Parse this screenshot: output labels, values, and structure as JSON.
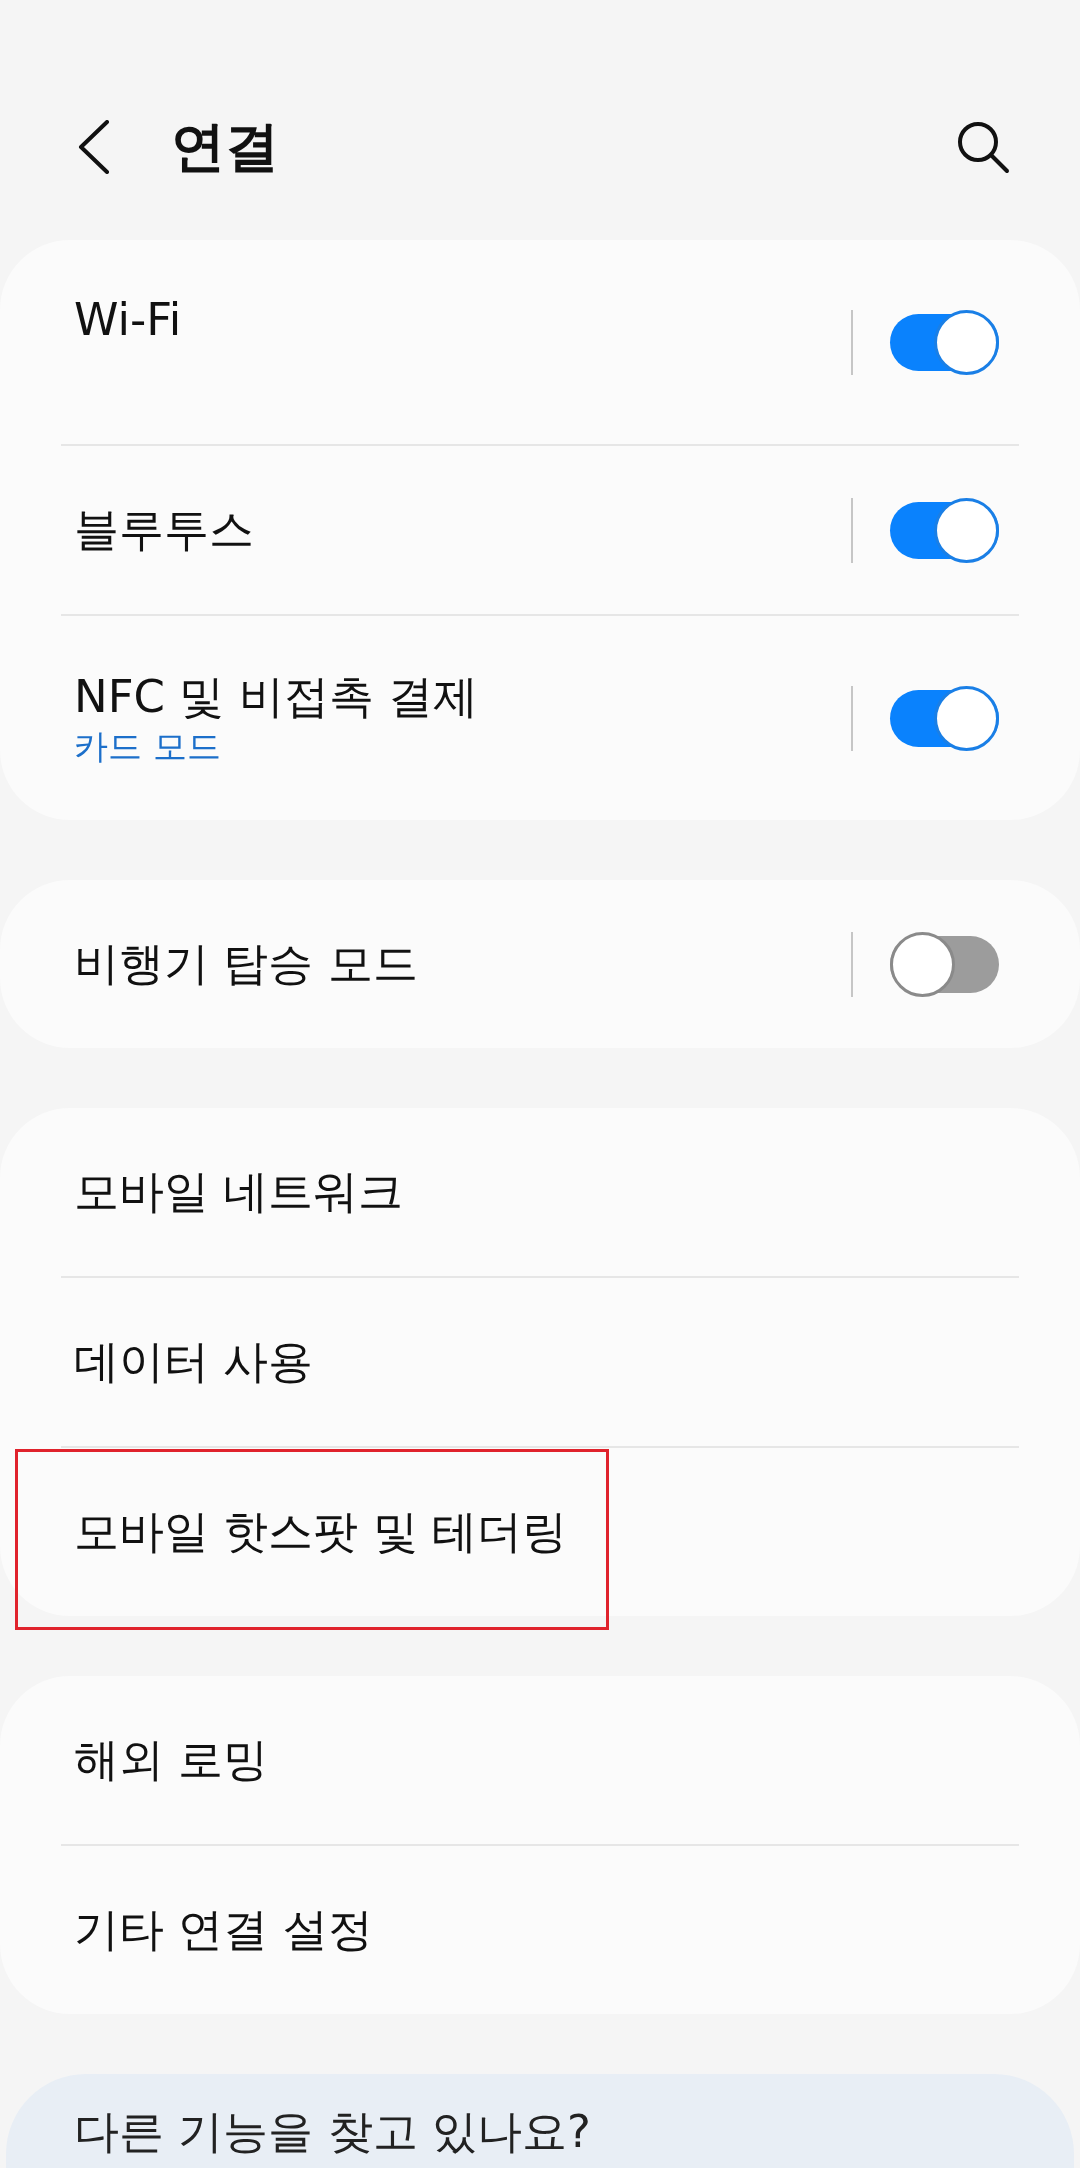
{
  "header": {
    "title": "연결"
  },
  "groups": [
    {
      "items": [
        {
          "kind": "toggle",
          "title": "Wi-Fi",
          "on": true,
          "highlighted": false
        },
        {
          "kind": "toggle",
          "title": "블루투스",
          "on": true,
          "highlighted": false
        },
        {
          "kind": "toggle",
          "title": "NFC 및 비접촉 결제",
          "subtitle": "카드 모드",
          "on": true,
          "highlighted": false
        }
      ]
    },
    {
      "items": [
        {
          "kind": "toggle",
          "title": "비행기 탑승 모드",
          "on": false,
          "highlighted": false
        }
      ]
    },
    {
      "items": [
        {
          "kind": "link",
          "title": "모바일 네트워크",
          "highlighted": false
        },
        {
          "kind": "link",
          "title": "데이터 사용",
          "highlighted": false
        },
        {
          "kind": "link",
          "title": "모바일 핫스팟 및 테더링",
          "highlighted": true
        }
      ]
    },
    {
      "items": [
        {
          "kind": "link",
          "title": "해외 로밍",
          "highlighted": false
        },
        {
          "kind": "link",
          "title": "기타 연결 설정",
          "highlighted": false
        }
      ]
    }
  ],
  "suggestion_card": {
    "title": "다른 기능을 찾고 있나요?"
  }
}
